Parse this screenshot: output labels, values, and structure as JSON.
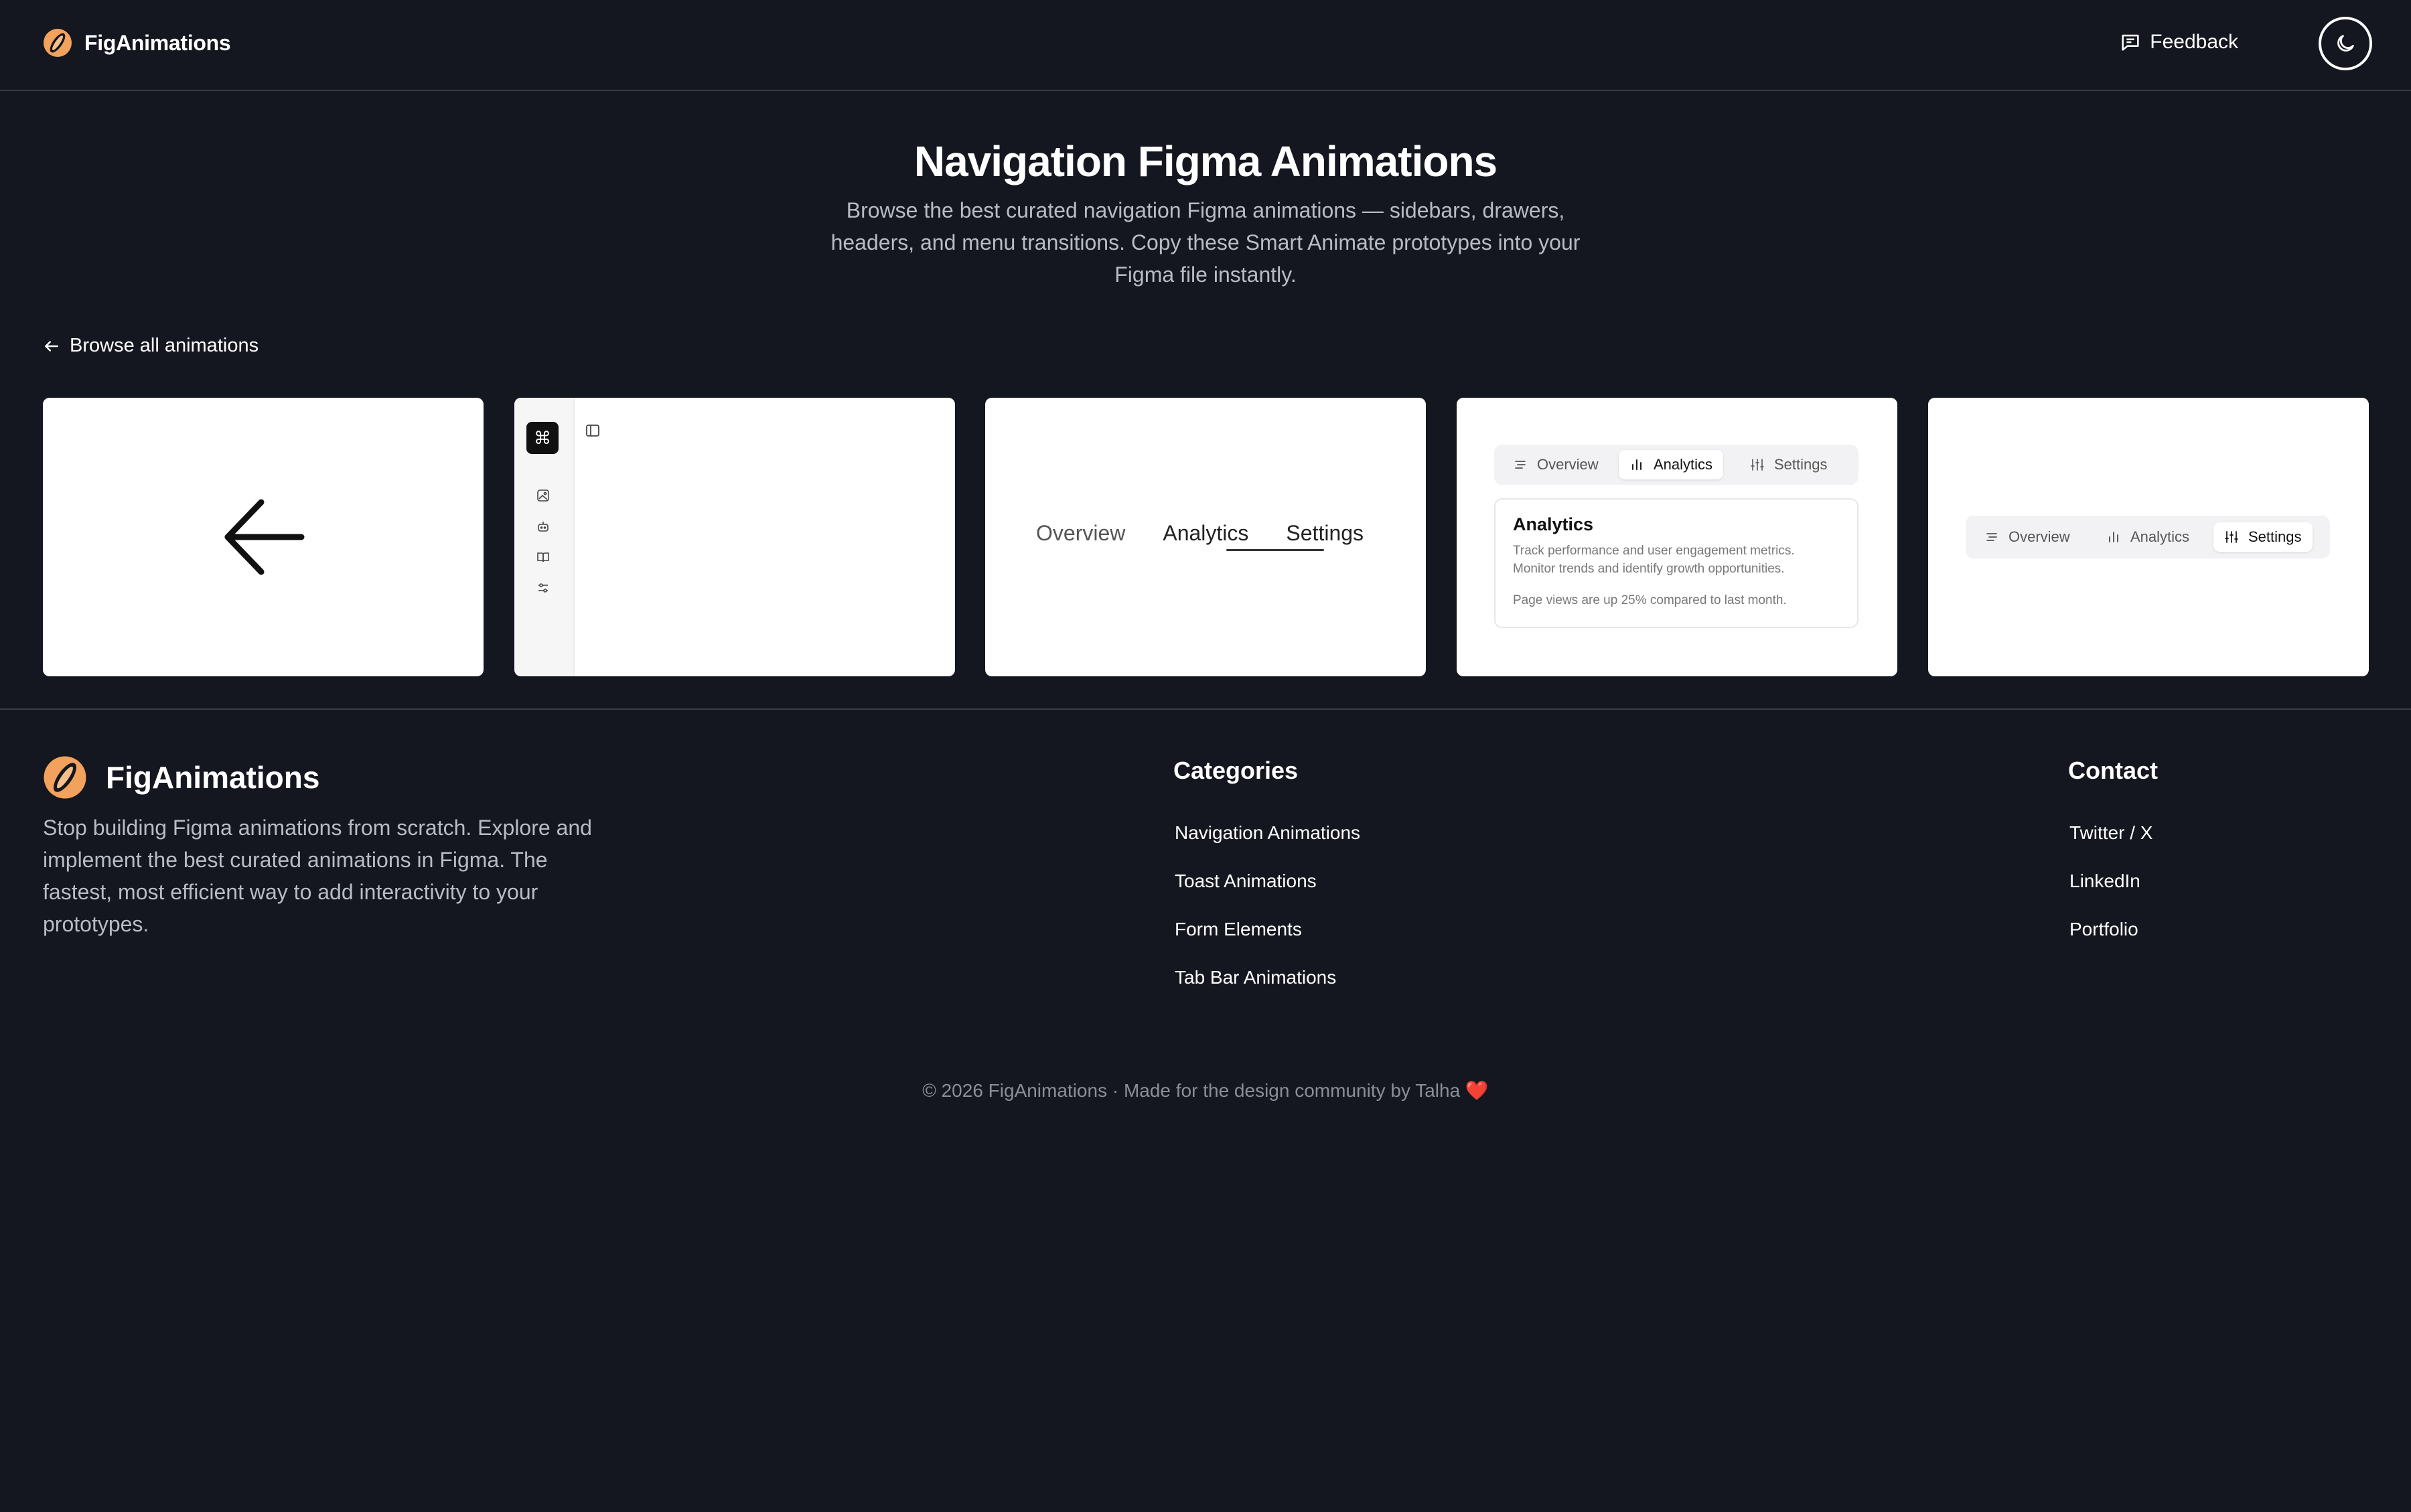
{
  "header": {
    "brand": "FigAnimations",
    "feedback_label": "Feedback"
  },
  "hero": {
    "title": "Navigation Figma Animations",
    "subtitle": "Browse the best curated navigation Figma animations — sidebars, drawers, headers, and menu transitions. Copy these Smart Animate prototypes into your Figma file instantly."
  },
  "back_link": "Browse all animations",
  "cards": {
    "sidebar_shortcut": "⌘",
    "underline_tabs": [
      "Overview",
      "Analytics",
      "Settings"
    ],
    "segmented_panel": {
      "tabs": [
        "Overview",
        "Analytics",
        "Settings"
      ],
      "active": "Analytics",
      "panel_title": "Analytics",
      "panel_text": "Track performance and user engagement metrics. Monitor trends and identify growth opportunities.",
      "panel_note": "Page views are up 25% compared to last month."
    },
    "segmented": {
      "tabs": [
        "Overview",
        "Analytics",
        "Settings"
      ],
      "active": "Settings"
    }
  },
  "footer": {
    "brand": "FigAnimations",
    "description": "Stop building Figma animations from scratch. Explore and implement the best curated animations in Figma. The fastest, most efficient way to add interactivity to your prototypes.",
    "categories_heading": "Categories",
    "categories": [
      "Navigation Animations",
      "Toast Animations",
      "Form Elements",
      "Tab Bar Animations"
    ],
    "contact_heading": "Contact",
    "contact": [
      "Twitter / X",
      "LinkedIn",
      "Portfolio"
    ],
    "copyright": "© 2026 FigAnimations · Made for the design community by Talha ❤️"
  },
  "colors": {
    "background": "#14171f",
    "logo_orange": "#f2a25c",
    "muted_text": "#b8bcc6"
  },
  "icons": [
    "logo-icon",
    "feedback-icon",
    "moon-icon",
    "arrow-left-icon",
    "command-icon",
    "image-icon",
    "bot-icon",
    "book-icon",
    "sliders-icon",
    "sidebar-panel-icon",
    "list-icon",
    "bar-chart-icon",
    "settings-sliders-icon"
  ]
}
